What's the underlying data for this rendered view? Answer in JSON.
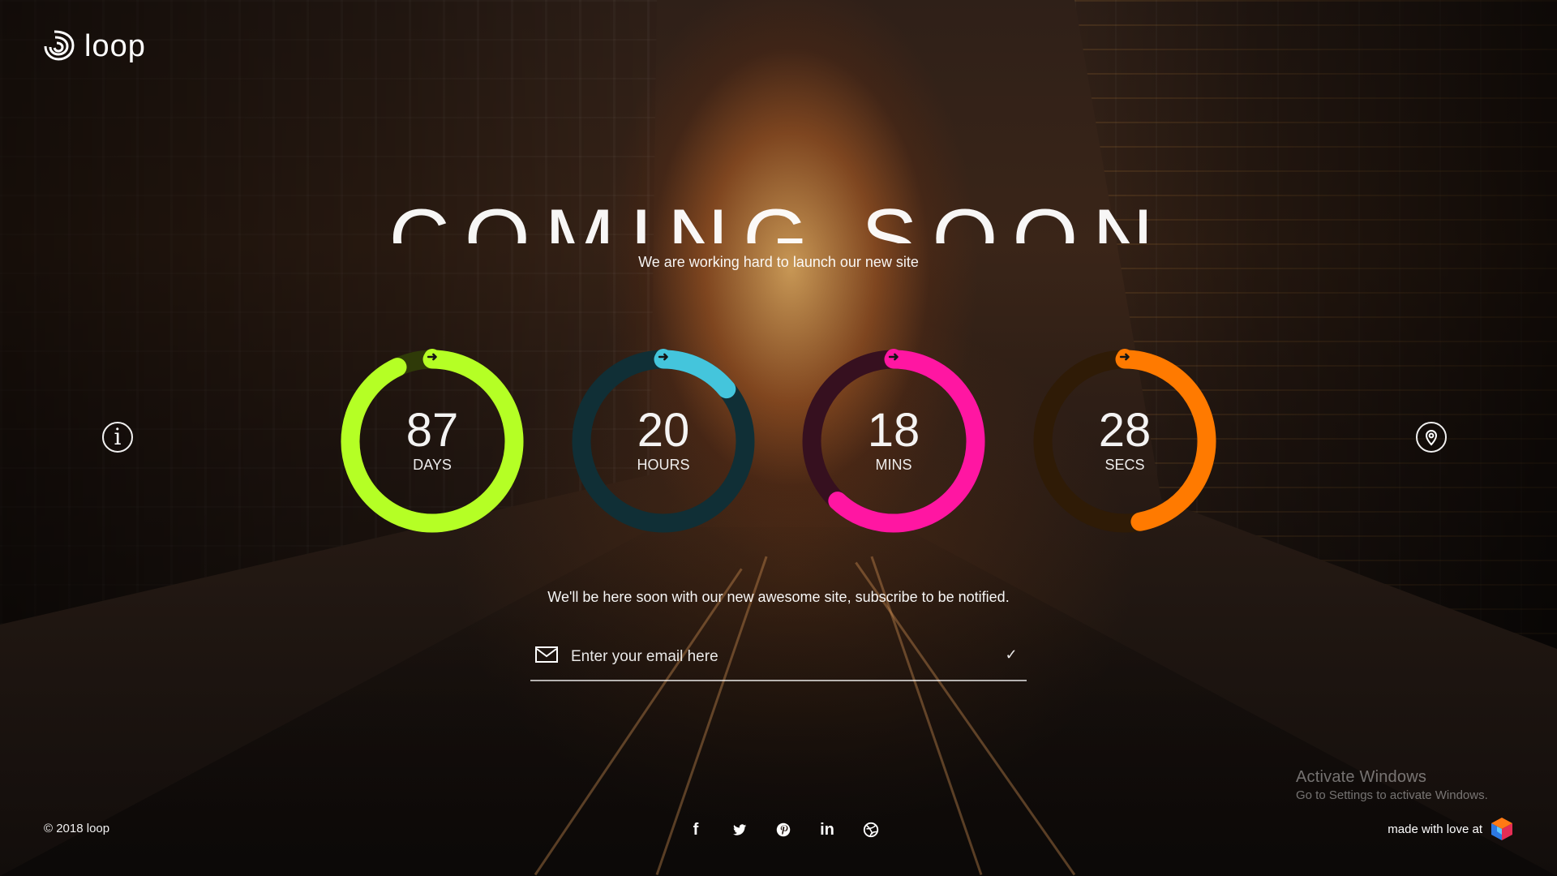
{
  "brand": {
    "logo_text": "loop"
  },
  "hero": {
    "title": "COMING SOON",
    "subtitle": "We are working hard to launch our new site"
  },
  "countdown": [
    {
      "value": "87",
      "label": "DAYS",
      "progress": 0.93,
      "track_color": "#2f3a08",
      "accent_color": "#b5ff25"
    },
    {
      "value": "20",
      "label": "HOURS",
      "progress": 0.14,
      "track_color": "#102f36",
      "accent_color": "#44c5dc"
    },
    {
      "value": "18",
      "label": "MINS",
      "progress": 0.62,
      "track_color": "#36101f",
      "accent_color": "#ff16a2"
    },
    {
      "value": "28",
      "label": "SECS",
      "progress": 0.47,
      "track_color": "#2f1b06",
      "accent_color": "#ff7a00"
    }
  ],
  "subscribe": {
    "note": "We'll be here soon with our new awesome site, subscribe to be notified.",
    "email_placeholder": "Enter your email here",
    "submit_label": "✓"
  },
  "icons": {
    "info": "info-icon",
    "location": "location-pin-icon",
    "mail": "mail-icon",
    "check": "check-icon",
    "facebook": "facebook-icon",
    "twitter": "twitter-icon",
    "pinterest": "pinterest-icon",
    "linkedin": "linkedin-icon",
    "dribbble": "dribbble-icon",
    "brand_cube": "brand-cube-icon"
  },
  "footer": {
    "copyright": "© 2018 loop",
    "made_with": "made with love at"
  },
  "windows_activation": {
    "title": "Activate Windows",
    "subtitle": "Go to Settings to activate Windows."
  }
}
